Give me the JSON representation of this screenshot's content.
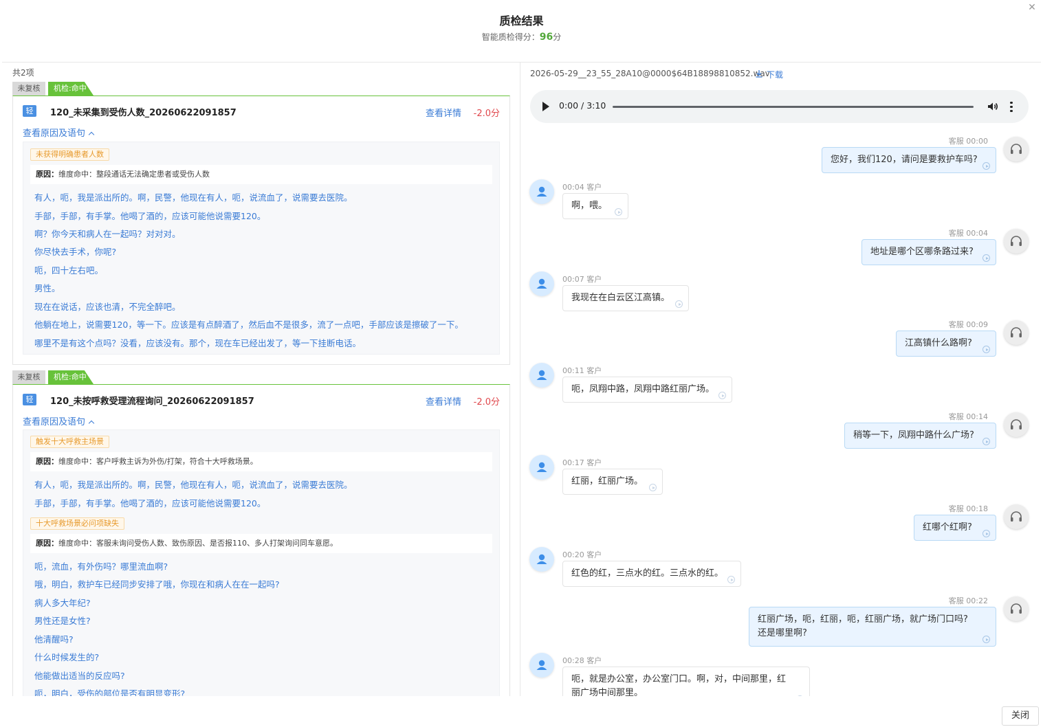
{
  "header": {
    "title": "质检结果",
    "score_label": "智能质检得分：",
    "score_value": "96",
    "score_unit": "分"
  },
  "left": {
    "count_label": "共2项",
    "issues": [
      {
        "tag_review": "未复核",
        "tag_hit": "机检:命中",
        "level": "轻",
        "name": "120_未采集到受伤人数_20260622091857",
        "detail_label": "查看详情",
        "deduction": "-2.0分",
        "reason_toggle": "查看原因及语句",
        "groups": [
          {
            "tag": "未获得明确患者人数",
            "reason_prefix": "原因：",
            "reason_text": "维度命中：整段通话无法确定患者或受伤人数",
            "sentences": [
              "有人，呃，我是派出所的。啊，民警，他现在有人，呃，说流血了，说需要去医院。",
              "手部，手部，有手掌。他喝了酒的，应该可能他说需要120。",
              "啊？你今天和病人在一起吗？对对对。",
              "你尽快去手术，你呢?",
              "呃，四十左右吧。",
              "男性。",
              "现在在说话，应该也清，不完全醉吧。",
              "他躺在地上，说需要120，等一下。应该是有点醉酒了，然后血不是很多，流了一点吧，手部应该是擦破了一下。",
              "哪里不是有这个点吗？没看，应该没有。那个，现在车已经出发了，等一下挂断电话。"
            ]
          }
        ]
      },
      {
        "tag_review": "未复核",
        "tag_hit": "机检:命中",
        "level": "轻",
        "name": "120_未按呼救受理流程询问_20260622091857",
        "detail_label": "查看详情",
        "deduction": "-2.0分",
        "reason_toggle": "查看原因及语句",
        "groups": [
          {
            "tag": "触发十大呼救主场景",
            "reason_prefix": "原因：",
            "reason_text": "维度命中：客户呼救主诉为外伤/打架，符合十大呼救场景。",
            "sentences": [
              "有人，呃，我是派出所的。啊，民警，他现在有人，呃，说流血了，说需要去医院。",
              "手部，手部，有手掌。他喝了酒的，应该可能他说需要120。"
            ]
          },
          {
            "tag": "十大呼救场景必问项缺失",
            "reason_prefix": "原因：",
            "reason_text": "维度命中：客服未询问受伤人数、致伤原因、是否报110、多人打架询问同车意愿。",
            "sentences": [
              "呃，流血，有外伤吗？哪里流血啊?",
              "哦，明白，救护车已经同步安排了哦，你现在和病人在在一起吗?",
              "病人多大年纪?",
              "男性还是女性?",
              "他清醒吗?",
              "什么时候发生的?",
              "他能做出适当的反应吗?",
              "呃，明白，受伤的部位是否有明显变形?"
            ]
          }
        ]
      }
    ]
  },
  "right": {
    "file_name": "2026-05-29__23_55_28A10@0000$64B18898810852.wav",
    "download_label": "下载",
    "player": {
      "time": "0:00 / 3:10",
      "progress": 0
    },
    "messages": [
      {
        "role": "agent",
        "speaker": "客服",
        "time": "00:00",
        "lines": [
          "您好，我们120，请问是要救护车吗?"
        ]
      },
      {
        "role": "cust",
        "speaker": "客户",
        "time": "00:04",
        "lines": [
          "啊，喂。"
        ]
      },
      {
        "role": "agent",
        "speaker": "客服",
        "time": "00:04",
        "lines": [
          "地址是哪个区哪条路过来?"
        ]
      },
      {
        "role": "cust",
        "speaker": "客户",
        "time": "00:07",
        "lines": [
          "我现在在白云区江高镇。"
        ]
      },
      {
        "role": "agent",
        "speaker": "客服",
        "time": "00:09",
        "lines": [
          "江高镇什么路啊?"
        ]
      },
      {
        "role": "cust",
        "speaker": "客户",
        "time": "00:11",
        "lines": [
          "呃，凤翔中路，凤翔中路红丽广场。"
        ]
      },
      {
        "role": "agent",
        "speaker": "客服",
        "time": "00:14",
        "lines": [
          "稍等一下，凤翔中路什么广场?"
        ]
      },
      {
        "role": "cust",
        "speaker": "客户",
        "time": "00:17",
        "lines": [
          "红丽，红丽广场。"
        ]
      },
      {
        "role": "agent",
        "speaker": "客服",
        "time": "00:18",
        "lines": [
          "红哪个红啊?"
        ]
      },
      {
        "role": "cust",
        "speaker": "客户",
        "time": "00:20",
        "lines": [
          "红色的红，三点水的红。三点水的红。"
        ]
      },
      {
        "role": "agent",
        "speaker": "客服",
        "time": "00:22",
        "lines": [
          "红丽广场，呃，红丽，呃，红丽广场，就广场门口吗?",
          "还是哪里啊?"
        ]
      },
      {
        "role": "cust",
        "speaker": "客户",
        "time": "00:28",
        "lines": [
          "呃，就是办公室，办公室门口。啊，对，中间那里，红",
          "丽广场中间那里。"
        ]
      }
    ]
  },
  "footer": {
    "close_label": "关闭"
  },
  "colors": {
    "accent": "#3a7bd5",
    "hit_green": "#67c23a",
    "deduct_red": "#e0474c",
    "score_green": "#52a83a"
  }
}
